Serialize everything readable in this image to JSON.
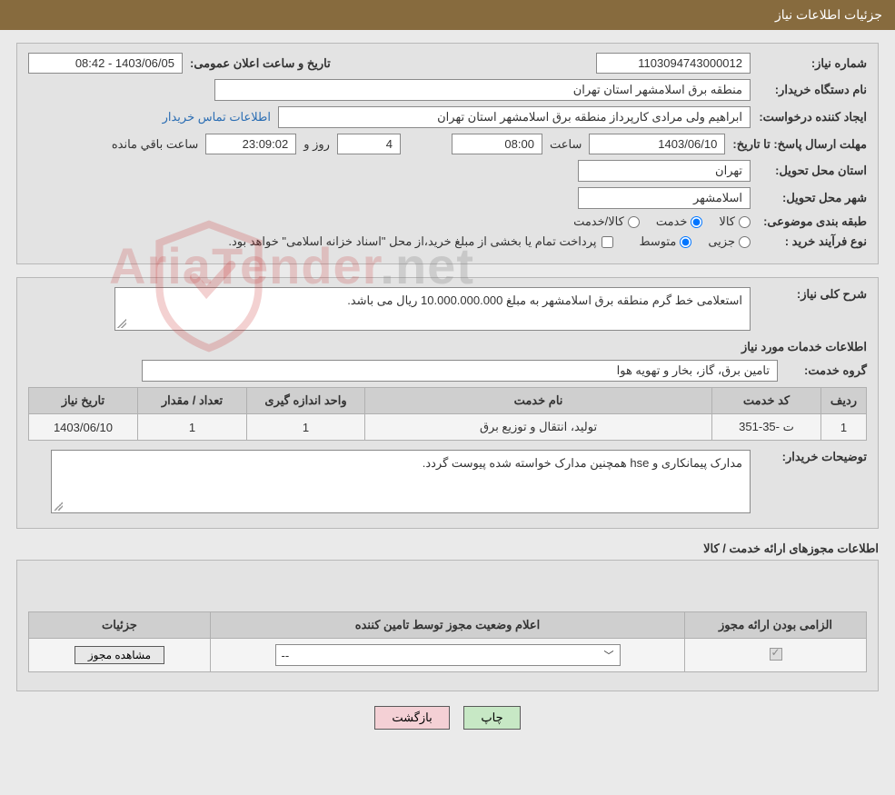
{
  "header": {
    "title": "جزئیات اطلاعات نیاز"
  },
  "labels": {
    "need_id": "شماره نیاز:",
    "announce_dt": "تاریخ و ساعت اعلان عمومی:",
    "buyer_org": "نام دستگاه خریدار:",
    "requester": "ایجاد کننده درخواست:",
    "contact_link": "اطلاعات تماس خریدار",
    "deadline": "مهلت ارسال پاسخ: تا تاریخ:",
    "time": "ساعت",
    "days": "روز و",
    "remaining": "ساعت باقي مانده",
    "province": "استان محل تحویل:",
    "city": "شهر محل تحویل:",
    "category": "طبقه بندی موضوعی:",
    "purchase_type": "نوع فرآیند خرید :",
    "payment_note": "پرداخت تمام یا بخشی از مبلغ خرید،از محل \"اسناد خزانه اسلامی\" خواهد بود.",
    "overall_desc": "شرح کلی نیاز:",
    "services_header": "اطلاعات خدمات مورد نیاز",
    "service_group": "گروه خدمت:",
    "buyer_notes": "توضیحات خریدار:",
    "auth_section": "اطلاعات مجوزهای ارائه خدمت / کالا"
  },
  "category_opts": {
    "goods": "کالا",
    "service": "خدمت",
    "both": "کالا/خدمت"
  },
  "purchase_opts": {
    "partial": "جزیی",
    "medium": "متوسط"
  },
  "fields": {
    "need_id": "1103094743000012",
    "announce_dt": "1403/06/05 - 08:42",
    "buyer_org": "منطقه برق اسلامشهر استان تهران",
    "requester": "ابراهیم ولی مرادی کارپرداز منطقه برق اسلامشهر استان تهران",
    "deadline_date": "1403/06/10",
    "deadline_time": "08:00",
    "remaining_days": "4",
    "remaining_time": "23:09:02",
    "province": "تهران",
    "city": "اسلامشهر",
    "overall_desc": "استعلامی خط گرم منطقه برق اسلامشهر به مبلغ 10.000.000.000 ریال می باشد.",
    "service_group": "تامین برق، گاز، بخار و تهویه هوا",
    "buyer_notes": "مدارک پیمانکاری و hse همچنین مدارک خواسته شده پیوست گردد."
  },
  "service_table": {
    "headers": {
      "row": "ردیف",
      "code": "کد خدمت",
      "name": "نام خدمت",
      "unit": "واحد اندازه گیری",
      "qty": "تعداد / مقدار",
      "date": "تاریخ نیاز"
    },
    "rows": [
      {
        "row": "1",
        "code": "ت -35-351",
        "name": "تولید، انتقال و توزیع برق",
        "unit": "1",
        "qty": "1",
        "date": "1403/06/10"
      }
    ]
  },
  "auth_table": {
    "headers": {
      "required": "الزامی بودن ارائه مجوز",
      "status": "اعلام وضعیت مجوز توسط تامین کننده",
      "details": "جزئیات"
    },
    "row": {
      "select_placeholder": "--",
      "view_btn": "مشاهده مجوز"
    }
  },
  "buttons": {
    "print": "چاپ",
    "back": "بازگشت"
  },
  "watermark": {
    "text_a": "AriaTender",
    "text_b": ".net"
  }
}
